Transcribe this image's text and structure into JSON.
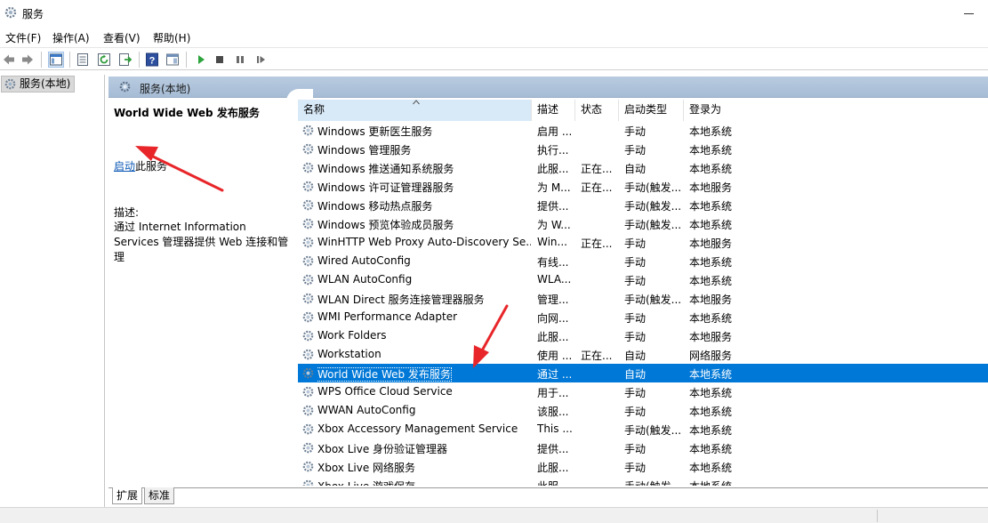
{
  "window": {
    "title": "服务"
  },
  "menu": [
    "文件(F)",
    "操作(A)",
    "查看(V)",
    "帮助(H)"
  ],
  "toolbar": {
    "buttons": [
      "back-icon",
      "forward-icon",
      "show-hide-console-tree-icon",
      "properties-icon",
      "refresh-icon",
      "export-list-icon",
      "help-icon",
      "extended-view-icon",
      "start-service-icon",
      "stop-service-icon",
      "pause-service-icon",
      "resume-service-icon"
    ]
  },
  "tree": {
    "root_label": "服务(本地)"
  },
  "pane_header": {
    "title": "服务(本地)"
  },
  "details": {
    "service_name": "World Wide Web 发布服务",
    "start_link": "启动",
    "start_suffix": "此服务",
    "description_label": "描述:",
    "description": "通过 Internet Information Services 管理器提供 Web 连接和管理"
  },
  "columns": {
    "name": "名称",
    "desc": "描述",
    "status": "状态",
    "startup": "启动类型",
    "logon": "登录为"
  },
  "rows": [
    {
      "name": "Windows 更新医生服务",
      "desc": "启用 ...",
      "status": "",
      "startup": "手动",
      "logon": "本地系统"
    },
    {
      "name": "Windows 管理服务",
      "desc": "执行...",
      "status": "",
      "startup": "手动",
      "logon": "本地系统"
    },
    {
      "name": "Windows 推送通知系统服务",
      "desc": "此服...",
      "status": "正在...",
      "startup": "自动",
      "logon": "本地系统"
    },
    {
      "name": "Windows 许可证管理器服务",
      "desc": "为 M...",
      "status": "正在...",
      "startup": "手动(触发...",
      "logon": "本地服务"
    },
    {
      "name": "Windows 移动热点服务",
      "desc": "提供...",
      "status": "",
      "startup": "手动(触发...",
      "logon": "本地系统"
    },
    {
      "name": "Windows 预览体验成员服务",
      "desc": "为 W...",
      "status": "",
      "startup": "手动(触发...",
      "logon": "本地系统"
    },
    {
      "name": "WinHTTP Web Proxy Auto-Discovery Se...",
      "desc": "Win...",
      "status": "正在...",
      "startup": "手动",
      "logon": "本地服务"
    },
    {
      "name": "Wired AutoConfig",
      "desc": "有线...",
      "status": "",
      "startup": "手动",
      "logon": "本地系统"
    },
    {
      "name": "WLAN AutoConfig",
      "desc": "WLA...",
      "status": "",
      "startup": "手动",
      "logon": "本地系统"
    },
    {
      "name": "WLAN Direct 服务连接管理器服务",
      "desc": "管理...",
      "status": "",
      "startup": "手动(触发...",
      "logon": "本地服务"
    },
    {
      "name": "WMI Performance Adapter",
      "desc": "向网...",
      "status": "",
      "startup": "手动",
      "logon": "本地系统"
    },
    {
      "name": "Work Folders",
      "desc": "此服...",
      "status": "",
      "startup": "手动",
      "logon": "本地服务"
    },
    {
      "name": "Workstation",
      "desc": "使用 ...",
      "status": "正在...",
      "startup": "自动",
      "logon": "网络服务"
    },
    {
      "name": "World Wide Web 发布服务",
      "desc": "通过 ...",
      "status": "",
      "startup": "自动",
      "logon": "本地系统",
      "selected": true
    },
    {
      "name": "WPS Office Cloud Service",
      "desc": "用于...",
      "status": "",
      "startup": "手动",
      "logon": "本地系统"
    },
    {
      "name": "WWAN AutoConfig",
      "desc": "该服...",
      "status": "",
      "startup": "手动",
      "logon": "本地系统"
    },
    {
      "name": "Xbox Accessory Management Service",
      "desc": "This ...",
      "status": "",
      "startup": "手动(触发...",
      "logon": "本地系统"
    },
    {
      "name": "Xbox Live 身份验证管理器",
      "desc": "提供...",
      "status": "",
      "startup": "手动",
      "logon": "本地系统"
    },
    {
      "name": "Xbox Live 网络服务",
      "desc": "此服...",
      "status": "",
      "startup": "手动",
      "logon": "本地系统"
    },
    {
      "name": "Xbox Live 游戏保存",
      "desc": "此服...",
      "status": "",
      "startup": "手动(触发...",
      "logon": "本地系统"
    }
  ],
  "tabs": [
    "扩展",
    "标准"
  ],
  "colors": {
    "selection": "#0078d7",
    "header_band": "#b8cbe0",
    "annotation_arrow": "#e8262a",
    "link": "#0b57b5"
  }
}
